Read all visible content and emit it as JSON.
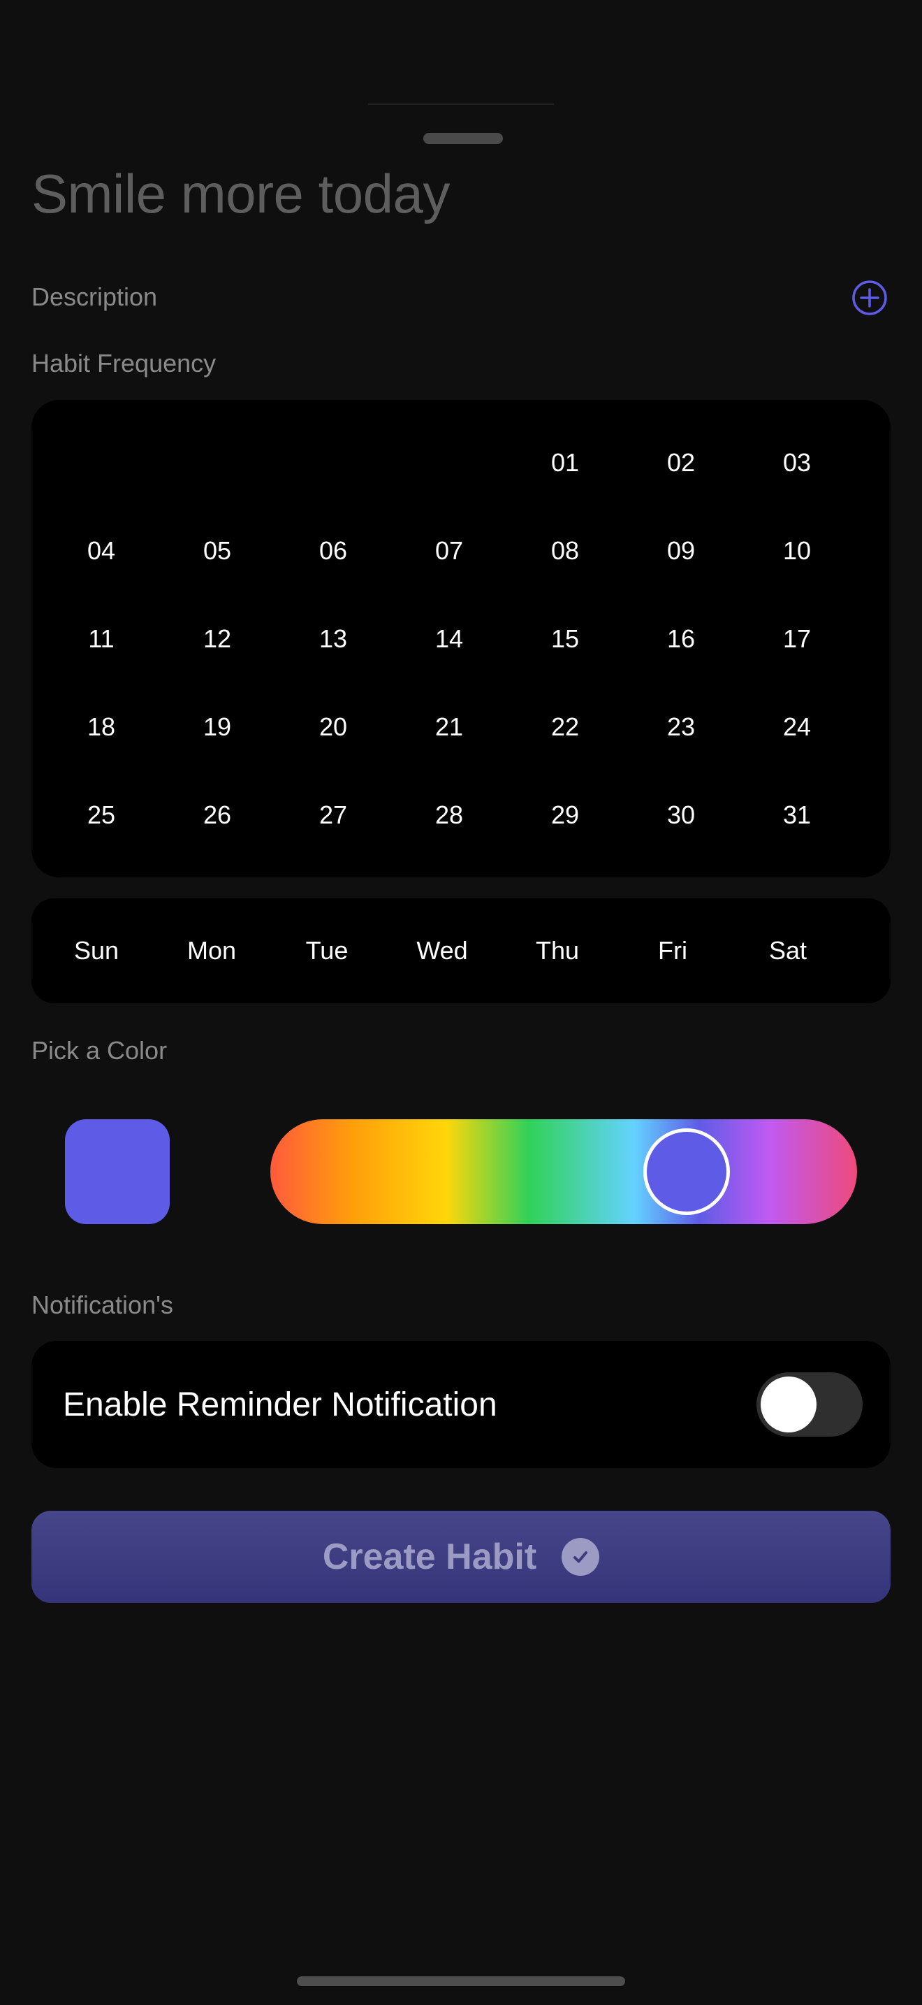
{
  "sheet": {
    "title": "Smile more today"
  },
  "description": {
    "label": "Description",
    "add_icon": "plus-circle-icon"
  },
  "frequency": {
    "label": "Habit Frequency",
    "days": [
      "01",
      "02",
      "03",
      "04",
      "05",
      "06",
      "07",
      "08",
      "09",
      "10",
      "11",
      "12",
      "13",
      "14",
      "15",
      "16",
      "17",
      "18",
      "19",
      "20",
      "21",
      "22",
      "23",
      "24",
      "25",
      "26",
      "27",
      "28",
      "29",
      "30",
      "31"
    ],
    "weekdays": [
      "Sun",
      "Mon",
      "Tue",
      "Wed",
      "Thu",
      "Fri",
      "Sat"
    ]
  },
  "color": {
    "label": "Pick a Color",
    "selected_hex": "#5e5ce6",
    "slider_value": 0.71,
    "gradient_stops": [
      "#ff5a3c",
      "#ff9f0a",
      "#ffd60a",
      "#30d158",
      "#64d2ff",
      "#5e5ce6",
      "#bf5af2",
      "#ee4a7a"
    ]
  },
  "notifications": {
    "label": "Notification's",
    "reminder_label": "Enable Reminder Notification",
    "reminder_enabled": false
  },
  "create_button": {
    "label": "Create Habit",
    "icon": "checkmark-circle-icon"
  },
  "colors": {
    "background": "#0f0f0f",
    "card": "#000000",
    "accent": "#5e5ce6"
  }
}
